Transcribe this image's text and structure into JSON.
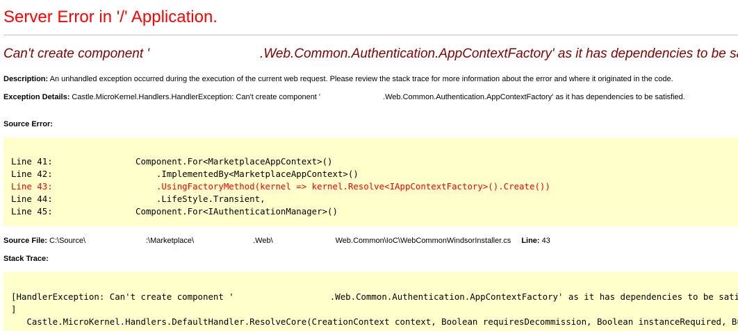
{
  "title": "Server Error in '/' Application.",
  "subtitle": {
    "part1": "Can't create component '",
    "part2": ".Web.Common.Authentication.AppContextFactory' as it has dependencies to be satisfied."
  },
  "description": {
    "label": "Description:",
    "text": "An unhandled exception occurred during the execution of the current web request. Please review the stack trace for more information about the error and where it originated in the code."
  },
  "exception_details": {
    "label": "Exception Details:",
    "part1": "Castle.MicroKernel.Handlers.HandlerException: Can't create component '",
    "part2": ".Web.Common.Authentication.AppContextFactory' as it has dependencies to be satisfied."
  },
  "source_error": {
    "label": "Source Error:",
    "lines": [
      {
        "text": "Line 41:                Component.For<MarketplaceAppContext>()",
        "error": false
      },
      {
        "text": "Line 42:                    .ImplementedBy<MarketplaceAppContext>()",
        "error": false
      },
      {
        "text": "Line 43:                    .UsingFactoryMethod(kernel => kernel.Resolve<IAppContextFactory>().Create())",
        "error": true
      },
      {
        "text": "Line 44:                    .LifeStyle.Transient,",
        "error": false
      },
      {
        "text": "Line 45:                Component.For<IAuthenticationManager>()",
        "error": false
      }
    ]
  },
  "source_file": {
    "label": "Source File:",
    "path1": "C:\\Source\\",
    "path2": ":\\Marketplace\\",
    "path3": ".Web\\",
    "path4": "Web.Common\\IoC\\WebCommonWindsorInstaller.cs",
    "line_label": "Line:",
    "line_value": "43"
  },
  "stack_trace": {
    "label": "Stack Trace:",
    "line1_part1": "[HandlerException: Can't create component '",
    "line1_part2": ".Web.Common.Authentication.AppContextFactory' as it has dependencies to be satisfied.",
    "line2": "]",
    "line3": "   Castle.MicroKernel.Handlers.DefaultHandler.ResolveCore(CreationContext context, Boolean requiresDecommission, Boolean instanceRequired, Burden& burden)"
  }
}
